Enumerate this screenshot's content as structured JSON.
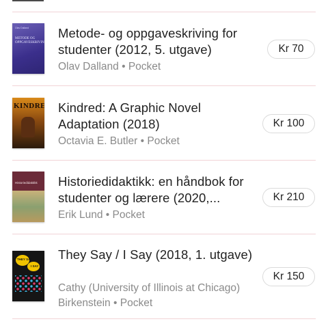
{
  "books": [
    {
      "title": "Metode- og oppgaveskriving for studenter (2012, 5. utgave)",
      "author": "Olav Dalland",
      "format": "Pocket",
      "price": "Kr 70",
      "cover": {
        "text": "METODE OG OPPGAVESKRIVING",
        "author_text": "Olav Dalland",
        "colors": [
          "#6a5fb5",
          "#2e2574"
        ]
      }
    },
    {
      "title": "Kindred: A Graphic Novel Adaptation (2018)",
      "author": "Octavia E. Butler",
      "format": "Pocket",
      "price": "Kr 100",
      "cover": {
        "text": "KINDRED",
        "colors": [
          "#d98a1a",
          "#2b1a0c"
        ]
      }
    },
    {
      "title": "Historiedidaktikk: en håndbok for studenter og lærere (2020,...",
      "author": "Erik Lund",
      "format": "Pocket",
      "price": "Kr 210",
      "cover": {
        "text": "Historiedidaktikk",
        "colors": [
          "#6b2a38",
          "#c8b27a"
        ]
      }
    },
    {
      "title": "They Say / I Say (2018, 1. utgave)",
      "author": "Cathy (University of Illinois at Chicago) Birkenstein",
      "format": "Pocket",
      "price": "Kr 150",
      "cover": {
        "text_1": "THEY SAY",
        "text_2": "I SAY",
        "colors": [
          "#151515",
          "#f2c400"
        ]
      }
    }
  ],
  "separator": "•"
}
